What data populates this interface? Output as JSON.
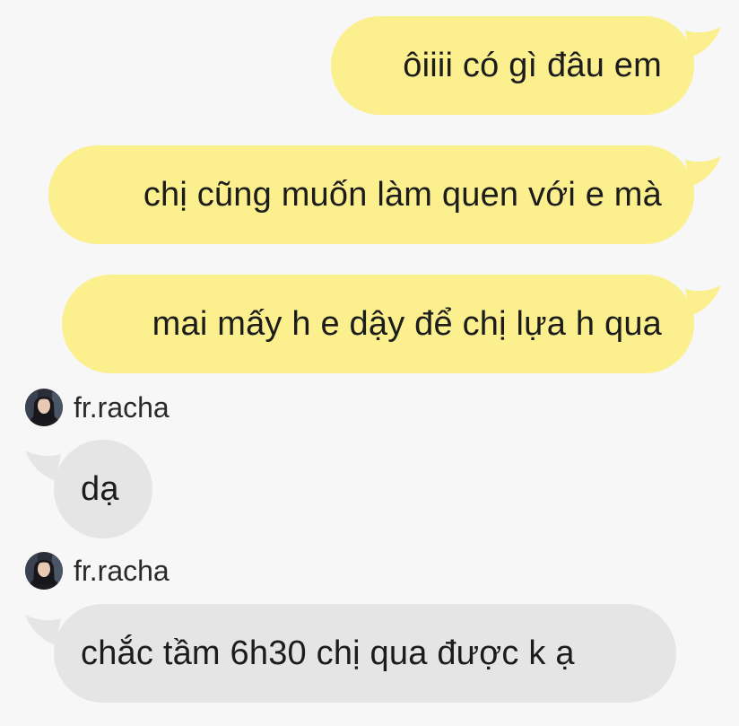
{
  "messages": [
    {
      "direction": "out",
      "text": "ôiiii có gì đâu em"
    },
    {
      "direction": "out",
      "text": "chị cũng muốn làm quen với e mà"
    },
    {
      "direction": "out",
      "text": "mai mấy h e dậy để chị lựa h qua"
    },
    {
      "direction": "in",
      "sender": "fr.racha",
      "text": "dạ"
    },
    {
      "direction": "in",
      "sender": "fr.racha",
      "text": "chắc tầm 6h30 chị qua được k ạ"
    }
  ],
  "colors": {
    "background": "#f7f7f7",
    "outgoing_bubble": "#fbef8e",
    "incoming_bubble": "#e5e5e5",
    "text": "#1c1c1c"
  },
  "icons": {
    "avatar": "avatar-icon"
  }
}
